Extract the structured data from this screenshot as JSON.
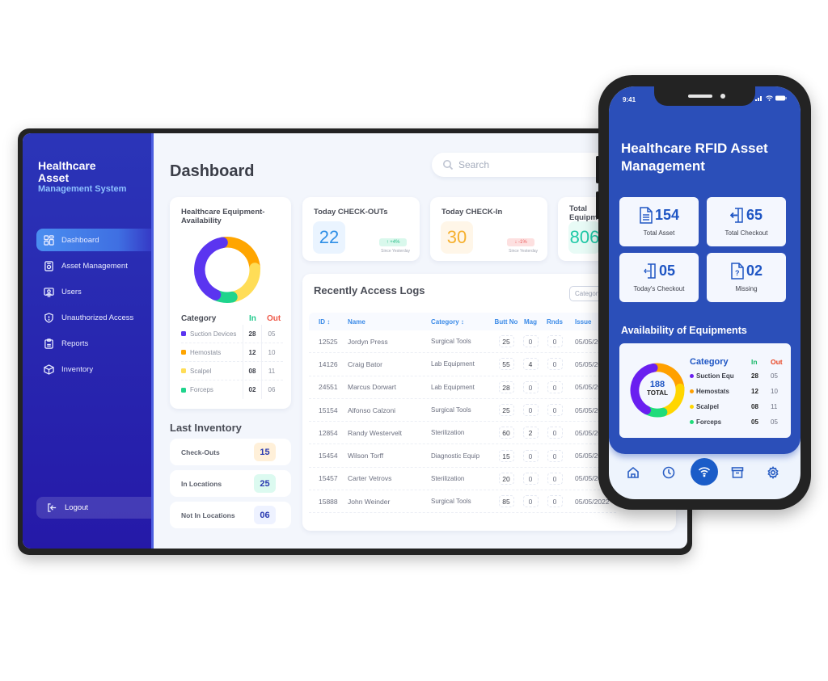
{
  "desktop": {
    "brand": {
      "line1": "Healthcare",
      "line2": "Asset",
      "line3": "Management System"
    },
    "sidebar": {
      "items": [
        {
          "label": "Dashboard",
          "icon": "grid-icon",
          "active": true
        },
        {
          "label": "Asset Management",
          "icon": "asset-box-icon",
          "active": false
        },
        {
          "label": "Users",
          "icon": "user-icon",
          "active": false
        },
        {
          "label": "Unauthorized Access",
          "icon": "shield-alert-icon",
          "active": false
        },
        {
          "label": "Reports",
          "icon": "clipboard-icon",
          "active": false
        },
        {
          "label": "Inventory",
          "icon": "cube-icon",
          "active": false
        }
      ],
      "logout_label": "Logout"
    },
    "header": {
      "title": "Dashboard",
      "search_placeholder": "Search"
    },
    "availability": {
      "title": "Healthcare Equipment-Availability",
      "headers": {
        "category": "Category",
        "in": "In",
        "out": "Out"
      },
      "rows": [
        {
          "name": "Suction Devices",
          "in": "28",
          "out": "05",
          "color": "#5b35f0"
        },
        {
          "name": "Hemostats",
          "in": "12",
          "out": "10",
          "color": "#ffa500"
        },
        {
          "name": "Scalpel",
          "in": "08",
          "out": "11",
          "color": "#ffdd57"
        },
        {
          "name": "Forceps",
          "in": "02",
          "out": "06",
          "color": "#1fd48c"
        }
      ]
    },
    "stats": [
      {
        "title": "Today CHECK-OUTs",
        "value": "22",
        "delta": "↑ +4%",
        "since": "Since Yesterday",
        "value_color": "#2f8fe6",
        "value_bg": "#eaf4ff",
        "delta_color": "#2bbf8a",
        "delta_bg": "#d9f8ec"
      },
      {
        "title": "Today CHECK-In",
        "value": "30",
        "delta": "↓ -1%",
        "since": "Since Yesterday",
        "value_color": "#f6b02e",
        "value_bg": "#fff6e8",
        "delta_color": "#ec5a5a",
        "delta_bg": "#fde0e0"
      },
      {
        "title": "Total Equipment Available",
        "title_visible": "Total Eq Availabl",
        "value": "806",
        "value_color": "#1fc9a7",
        "value_bg": "#e8fbf6"
      }
    ],
    "inventory": {
      "title": "Last Inventory",
      "items": [
        {
          "label": "Check-Outs",
          "value": "15",
          "bg": "#fff0d9"
        },
        {
          "label": "In Locations",
          "value": "25",
          "bg": "#dcfaf0"
        },
        {
          "label": "Not In Locations",
          "value": "06",
          "bg": "#eef2ff"
        }
      ]
    },
    "logs": {
      "title": "Recently Access Logs",
      "filter_label": "Category",
      "columns": [
        "ID ↕",
        "Name",
        "Category ↕",
        "Butt No",
        "Mag",
        "Rnds",
        "Issue"
      ],
      "rows": [
        {
          "id": "12525",
          "name": "Jordyn Press",
          "category": "Surgical Tools",
          "butt": "25",
          "mag": "0",
          "rnds": "0",
          "issue": "05/05/2022"
        },
        {
          "id": "14126",
          "name": "Craig Bator",
          "category": "Lab Equipment",
          "butt": "55",
          "mag": "4",
          "rnds": "0",
          "issue": "05/05/2022"
        },
        {
          "id": "24551",
          "name": "Marcus Dorwart",
          "category": "Lab Equipment",
          "butt": "28",
          "mag": "0",
          "rnds": "0",
          "issue": "05/05/2022"
        },
        {
          "id": "15154",
          "name": "Alfonso Calzoni",
          "category": "Surgical Tools",
          "butt": "25",
          "mag": "0",
          "rnds": "0",
          "issue": "05/05/2022"
        },
        {
          "id": "12854",
          "name": "Randy Westervelt",
          "category": "Sterilization",
          "butt": "60",
          "mag": "2",
          "rnds": "0",
          "issue": "05/05/2022"
        },
        {
          "id": "15454",
          "name": "Wilson Torff",
          "category": "Diagnostic Equip",
          "butt": "15",
          "mag": "0",
          "rnds": "0",
          "issue": "05/05/2022"
        },
        {
          "id": "15457",
          "name": "Carter Vetrovs",
          "category": "Sterilization",
          "butt": "20",
          "mag": "0",
          "rnds": "0",
          "issue": "05/05/2022"
        },
        {
          "id": "15888",
          "name": "John Weinder",
          "category": "Surgical Tools",
          "butt": "85",
          "mag": "0",
          "rnds": "0",
          "issue": "05/05/2022"
        }
      ]
    }
  },
  "phone": {
    "status_time": "9:41",
    "title": "Healthcare RFID Asset Management",
    "tiles": [
      {
        "value": "154",
        "label": "Total Asset",
        "icon": "document-icon"
      },
      {
        "value": "65",
        "label": "Total Checkout",
        "icon": "door-enter-icon"
      },
      {
        "value": "05",
        "label": "Today's Checkout",
        "icon": "door-exit-icon"
      },
      {
        "value": "02",
        "label": "Missing",
        "icon": "question-file-icon"
      }
    ],
    "availability": {
      "title": "Availability of Equipments",
      "total_value": "188",
      "total_label": "TOTAL",
      "headers": {
        "category": "Category",
        "in": "In",
        "out": "Out"
      },
      "rows": [
        {
          "name": "Suction Equ",
          "in": "28",
          "out": "05",
          "color": "#6a1ff0"
        },
        {
          "name": "Hemostats",
          "in": "12",
          "out": "10",
          "color": "#ffa000"
        },
        {
          "name": "Scalpel",
          "in": "08",
          "out": "11",
          "color": "#ffd600"
        },
        {
          "name": "Forceps",
          "in": "05",
          "out": "05",
          "color": "#1fdc7a"
        }
      ]
    },
    "tabbar": [
      "home-icon",
      "clock-icon",
      "rfid-wifi-icon",
      "archive-icon",
      "settings-icon"
    ]
  }
}
